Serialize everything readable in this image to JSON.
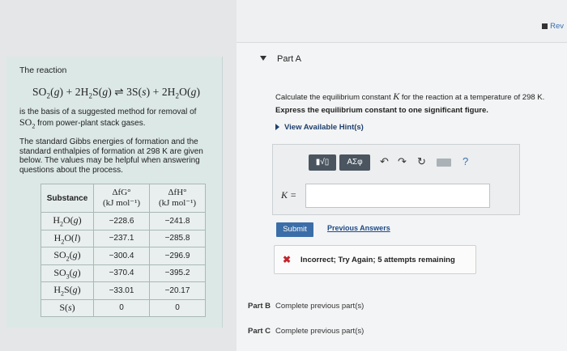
{
  "left": {
    "reaction_heading": "The reaction",
    "basis_pre": "is the basis of a suggested method for removal of",
    "basis_formula": "SO",
    "basis_formula_sub": "2",
    "basis_post": " from power-plant stack gases.",
    "gibbs_text": "The standard Gibbs energies of formation and the standard enthalpies of formation at 298 K are given below. The values may be helpful when answering questions about the process.",
    "table": {
      "header_substance": "Substance",
      "header_g_top": "ΔfG°",
      "header_h_top": "ΔfH°",
      "header_units": "(kJ mol⁻¹)",
      "rows": [
        {
          "substance": "H2O(g)",
          "g": "−228.6",
          "h": "−241.8"
        },
        {
          "substance": "H2O(l)",
          "g": "−237.1",
          "h": "−285.8"
        },
        {
          "substance": "SO2(g)",
          "g": "−300.4",
          "h": "−296.9"
        },
        {
          "substance": "SO3(g)",
          "g": "−370.4",
          "h": "−395.2"
        },
        {
          "substance": "H2S(g)",
          "g": "−33.01",
          "h": "−20.17"
        },
        {
          "substance": "S(s)",
          "g": "0",
          "h": "0"
        }
      ]
    }
  },
  "right": {
    "review_label": "Rev",
    "part_a_title": "Part A",
    "question_pre": "Calculate the equilibrium constant ",
    "question_var": "K",
    "question_post": " for the reaction at a temperature of 298 K.",
    "instruction": "Express the equilibrium constant to one significant figure.",
    "hint_label": "View Available Hint(s)",
    "toolbar": {
      "templates_label": "▮√▯",
      "greek_label": "ΑΣφ",
      "undo_icon": "undo-icon",
      "redo_icon": "redo-icon",
      "reset_icon": "reset-icon",
      "keyboard_icon": "keyboard-icon",
      "help_label": "?"
    },
    "k_label": "K =",
    "k_value": "",
    "submit_label": "Submit",
    "previous_answers_label": "Previous Answers",
    "feedback": "Incorrect; Try Again; 5 attempts remaining",
    "part_b": {
      "label": "Part B",
      "text": "Complete previous part(s)"
    },
    "part_c": {
      "label": "Part C",
      "text": "Complete previous part(s)"
    }
  },
  "colors": {
    "left_panel_bg": "#dbe8e6",
    "submit_blue": "#3b6ea8",
    "error_red": "#c0262d",
    "link_blue": "#1e4a86"
  }
}
